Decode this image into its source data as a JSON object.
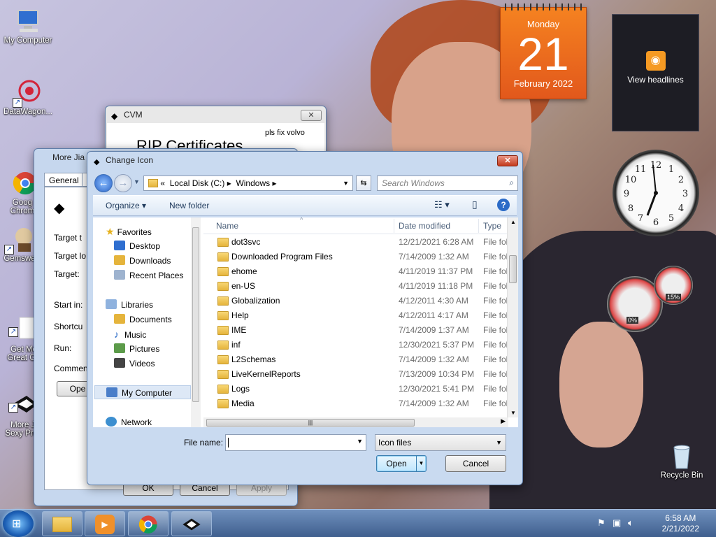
{
  "desktop": {
    "icons": [
      {
        "label": "My Computer"
      },
      {
        "label": "DataWagon..."
      },
      {
        "label": "Goog\nChrom"
      },
      {
        "label": "Gemswe"
      },
      {
        "label": "Get Mo\nGreat Ga"
      },
      {
        "label": "More Ji\nSexy Prod"
      },
      {
        "label": "Recycle Bin"
      }
    ]
  },
  "gadgets": {
    "calendar": {
      "weekday": "Monday",
      "day": "21",
      "month_year": "February 2022"
    },
    "feed": {
      "label": "View headlines"
    },
    "meter": {
      "cpu": "0%",
      "mem": "15%"
    }
  },
  "cvm_window": {
    "title": "CVM",
    "note": "pls fix volvo",
    "heading": "RIP Certificates"
  },
  "props_window": {
    "title": "More Jia",
    "tabs": [
      "General",
      "S"
    ],
    "labels": [
      "Target t",
      "Target lo",
      "Target:",
      "Start in:",
      "Shortcu",
      "Run:",
      "Commen"
    ],
    "open_button": "Ope",
    "ok": "OK",
    "cancel": "Cancel",
    "apply": "Apply"
  },
  "dialog": {
    "title": "Change Icon",
    "address": {
      "prefix": "«",
      "drive": "Local Disk (C:)",
      "sep": "▸",
      "folder": "Windows"
    },
    "search_placeholder": "Search Windows",
    "toolbar": {
      "organize": "Organize ▾",
      "new_folder": "New folder"
    },
    "nav": {
      "favorites": "Favorites",
      "desktop": "Desktop",
      "downloads": "Downloads",
      "recent": "Recent Places",
      "libraries": "Libraries",
      "documents": "Documents",
      "music": "Music",
      "pictures": "Pictures",
      "videos": "Videos",
      "computer": "My Computer",
      "network": "Network"
    },
    "columns": {
      "name": "Name",
      "date": "Date modified",
      "type": "Type"
    },
    "files": [
      {
        "name": "dot3svc",
        "date": "12/21/2021 6:28 AM",
        "type": "File fol"
      },
      {
        "name": "Downloaded Program Files",
        "date": "7/14/2009 1:32 AM",
        "type": "File fol"
      },
      {
        "name": "ehome",
        "date": "4/11/2019 11:37 PM",
        "type": "File fol"
      },
      {
        "name": "en-US",
        "date": "4/11/2019 11:18 PM",
        "type": "File fol"
      },
      {
        "name": "Globalization",
        "date": "4/12/2011 4:30 AM",
        "type": "File fol"
      },
      {
        "name": "Help",
        "date": "4/12/2011 4:17 AM",
        "type": "File fol"
      },
      {
        "name": "IME",
        "date": "7/14/2009 1:37 AM",
        "type": "File fol"
      },
      {
        "name": "inf",
        "date": "12/30/2021 5:37 PM",
        "type": "File fol"
      },
      {
        "name": "L2Schemas",
        "date": "7/14/2009 1:32 AM",
        "type": "File fol"
      },
      {
        "name": "LiveKernelReports",
        "date": "7/13/2009 10:34 PM",
        "type": "File fol"
      },
      {
        "name": "Logs",
        "date": "12/30/2021 5:41 PM",
        "type": "File fol"
      },
      {
        "name": "Media",
        "date": "7/14/2009 1:32 AM",
        "type": "File fol"
      }
    ],
    "file_name_label": "File name:",
    "file_name_value": "",
    "file_type": "Icon files",
    "open": "Open",
    "cancel": "Cancel"
  },
  "taskbar": {
    "time": "6:58 AM",
    "date": "2/21/2022"
  },
  "colors": {
    "accent": "#2660c4",
    "calendar": "#f58220",
    "taskbar": "#3f5f8e"
  }
}
